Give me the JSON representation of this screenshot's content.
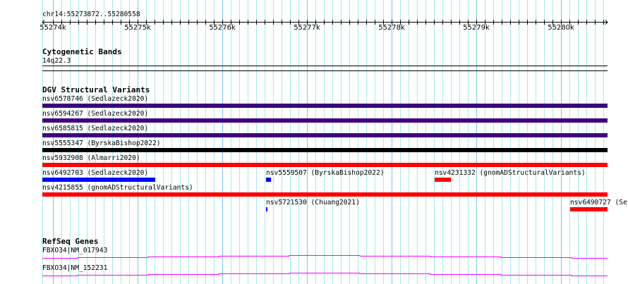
{
  "ruler": {
    "region": "chr14:55273872..55280558",
    "ticks": [
      "55274k",
      "55275k",
      "55276k",
      "55277k",
      "55278k",
      "55279k",
      "55280k"
    ]
  },
  "cytoband": {
    "title": "Cytogenetic Bands",
    "band": "14q22.3"
  },
  "dgv": {
    "title": "DGV Structural Variants",
    "features": [
      {
        "label": "nsv6578746 (Sedlazeck2020)",
        "color": "#400080"
      },
      {
        "label": "nsv6594267 (Sedlazeck2020)",
        "color": "#400080"
      },
      {
        "label": "nsv6585815 (Sedlazeck2020)",
        "color": "#400080"
      },
      {
        "label": "nsv5555347 (ByrskaBishop2022)",
        "color": "#000000"
      },
      {
        "label": "nsv5932908 (Almarri2020)",
        "color": "#ff0000"
      },
      {
        "label": "nsv6492703 (Sedlazeck2020)",
        "color": "#0000ff"
      },
      {
        "label": "nsv5559507 (ByrskaBishop2022)",
        "color": "#0000ff"
      },
      {
        "label": "nsv4231332 (gnomADStructuralVariants)",
        "color": "#ff0000"
      },
      {
        "label": "nsv4215855 (gnomADStructuralVariants)",
        "color": "#ff0000"
      },
      {
        "label": "nsv5721530 (Chuang2021)",
        "color": "#0000ff"
      },
      {
        "label": "nsv6490727 (Se",
        "color": "#ff0000"
      }
    ]
  },
  "refseq": {
    "title": "RefSeq Genes",
    "genes": [
      "FBXO34|NM_017943",
      "FBXO34|NM_152231"
    ],
    "color": "#ff00ff"
  }
}
